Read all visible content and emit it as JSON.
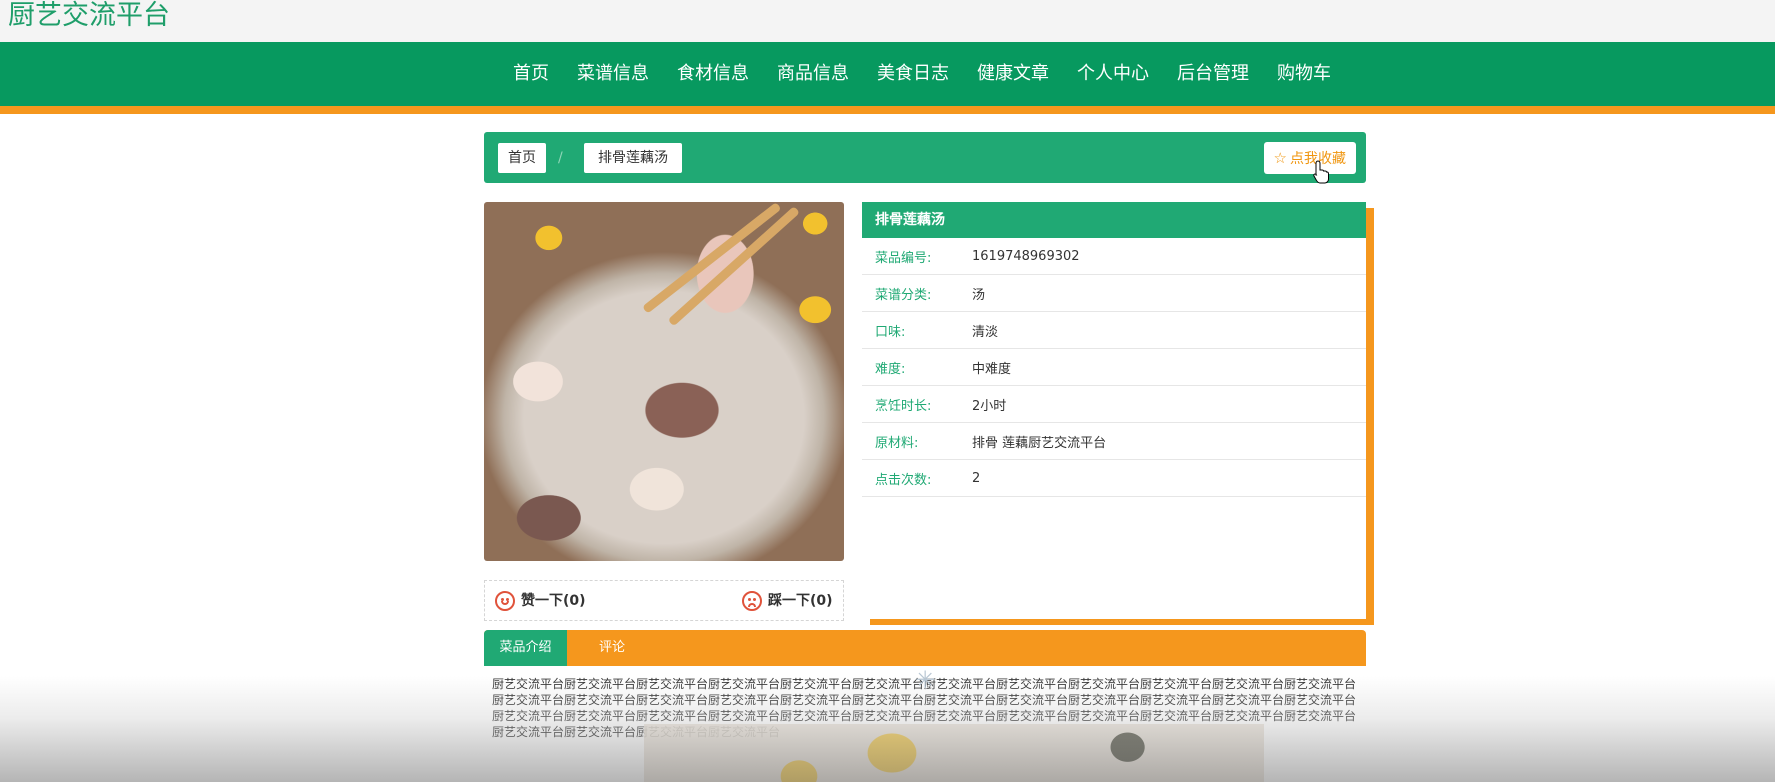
{
  "site": {
    "title": "厨艺交流平台"
  },
  "nav": {
    "items": [
      "首页",
      "菜谱信息",
      "食材信息",
      "商品信息",
      "美食日志",
      "健康文章",
      "个人中心",
      "后台管理",
      "购物车"
    ]
  },
  "breadcrumb": {
    "home": "首页",
    "separator": "/",
    "current": "排骨莲藕汤",
    "favorite_label": "点我收藏"
  },
  "colors": {
    "primary": "#07995f",
    "panel": "#20a974",
    "accent": "#f5971d"
  },
  "recipe": {
    "title": "排骨莲藕汤",
    "fields": [
      {
        "label": "菜品编号:",
        "value": "1619748969302"
      },
      {
        "label": "菜谱分类:",
        "value": "汤"
      },
      {
        "label": "口味:",
        "value": "清淡"
      },
      {
        "label": "难度:",
        "value": "中难度"
      },
      {
        "label": "烹饪时长:",
        "value": "2小时"
      },
      {
        "label": "原材料:",
        "value": "排骨 莲藕厨艺交流平台"
      },
      {
        "label": "点击次数:",
        "value": "2"
      }
    ]
  },
  "votes": {
    "like": "赞一下(0)",
    "dislike": "踩一下(0)"
  },
  "tabs": {
    "intro": "菜品介绍",
    "comment": "评论"
  },
  "description": "厨艺交流平台厨艺交流平台厨艺交流平台厨艺交流平台厨艺交流平台厨艺交流平台厨艺交流平台厨艺交流平台厨艺交流平台厨艺交流平台厨艺交流平台厨艺交流平台厨艺交流平台厨艺交流平台厨艺交流平台厨艺交流平台厨艺交流平台厨艺交流平台厨艺交流平台厨艺交流平台厨艺交流平台厨艺交流平台厨艺交流平台厨艺交流平台厨艺交流平台厨艺交流平台厨艺交流平台厨艺交流平台厨艺交流平台厨艺交流平台厨艺交流平台厨艺交流平台厨艺交流平台厨艺交流平台厨艺交流平台厨艺交流平台厨艺交流平台厨艺交流平台厨艺交流平台厨艺交流平台"
}
